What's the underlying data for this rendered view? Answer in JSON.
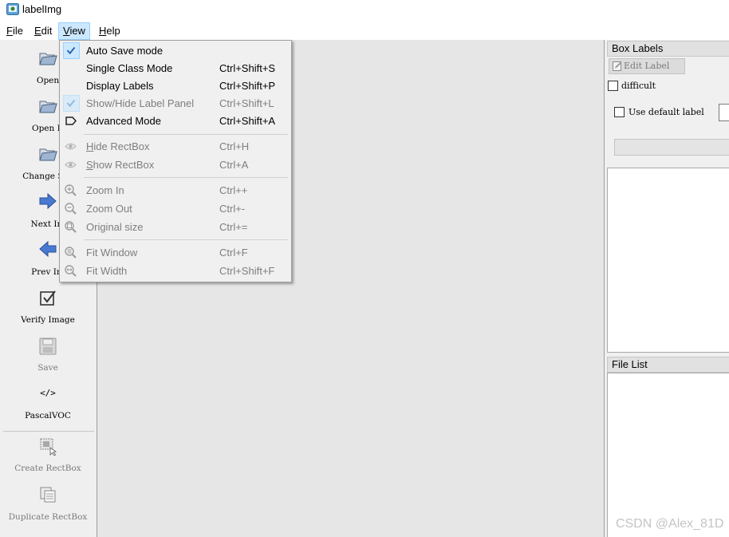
{
  "window": {
    "title": "labelImg",
    "icon": "labelimg-app-icon"
  },
  "menubar": [
    {
      "label": "File",
      "mnemonic": "F",
      "rest": "ile"
    },
    {
      "label": "Edit",
      "mnemonic": "E",
      "rest": "dit"
    },
    {
      "label": "View",
      "mnemonic": "V",
      "rest": "iew",
      "active": true
    },
    {
      "label": "Help",
      "mnemonic": "H",
      "rest": "elp"
    }
  ],
  "toolbar": {
    "open": "Open",
    "open_dir": "Open D",
    "change_save_dir": "Change Sav",
    "next_image": "Next Im",
    "prev_image": "Prev Im",
    "verify_image": "Verify Image",
    "save": "Save",
    "format": "PascalVOC",
    "format_icon_text": "</>",
    "create_rectbox": "Create RectBox",
    "duplicate_rectbox": "Duplicate RectBox"
  },
  "view_menu": {
    "auto_save": {
      "label": "Auto Save mode",
      "shortcut": "",
      "checked": true
    },
    "single_class": {
      "label": "Single Class Mode",
      "shortcut": "Ctrl+Shift+S"
    },
    "display_labels": {
      "label": "Display Labels",
      "shortcut": "Ctrl+Shift+P"
    },
    "show_hide_label_panel": {
      "label": "Show/Hide Label Panel",
      "shortcut": "Ctrl+Shift+L",
      "checked": true,
      "disabled": true
    },
    "advanced_mode": {
      "label": "Advanced Mode",
      "shortcut": "Ctrl+Shift+A"
    },
    "hide_rectbox": {
      "label": "Hide RectBox",
      "mnemonic": "H",
      "rest": "ide RectBox",
      "shortcut": "Ctrl+H",
      "disabled": true
    },
    "show_rectbox": {
      "label": "Show RectBox",
      "mnemonic": "S",
      "rest": "how RectBox",
      "shortcut": "Ctrl+A",
      "disabled": true
    },
    "zoom_in": {
      "label": "Zoom In",
      "shortcut": "Ctrl++",
      "disabled": true
    },
    "zoom_out": {
      "label": "Zoom Out",
      "shortcut": "Ctrl+-",
      "disabled": true
    },
    "original_size": {
      "label": "Original size",
      "shortcut": "Ctrl+=",
      "disabled": true
    },
    "fit_window": {
      "label": "Fit Window",
      "shortcut": "Ctrl+F",
      "disabled": true
    },
    "fit_width": {
      "label": "Fit Width",
      "shortcut": "Ctrl+Shift+F",
      "disabled": true
    }
  },
  "box_labels": {
    "title": "Box Labels",
    "edit_label": "Edit Label",
    "difficult": "difficult",
    "use_default_label": "Use default label",
    "default_label_value": ""
  },
  "file_list": {
    "title": "File List"
  },
  "watermark": "CSDN @Alex_81D",
  "colors": {
    "menu_highlight": "#cce8ff",
    "canvas": "#e6e6e6",
    "disabled_text": "#7e7e7e"
  }
}
